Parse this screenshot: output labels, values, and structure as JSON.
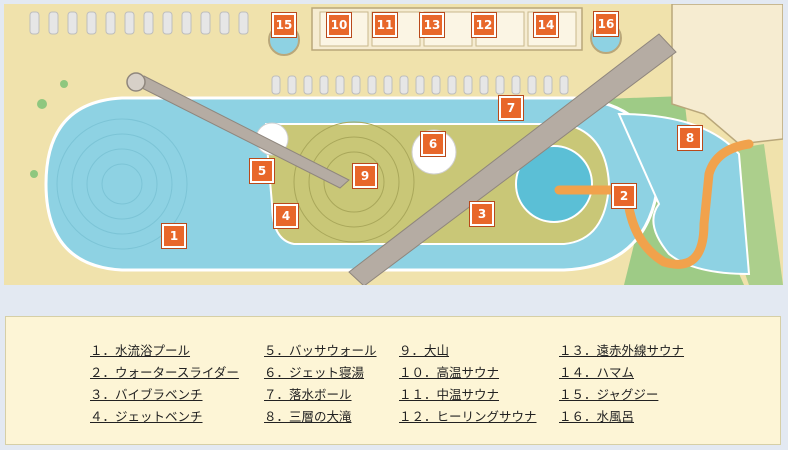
{
  "map": {
    "markers": [
      {
        "id": "1",
        "label": "1"
      },
      {
        "id": "2",
        "label": "2"
      },
      {
        "id": "3",
        "label": "3"
      },
      {
        "id": "4",
        "label": "4"
      },
      {
        "id": "5",
        "label": "5"
      },
      {
        "id": "6",
        "label": "6"
      },
      {
        "id": "7",
        "label": "7"
      },
      {
        "id": "8",
        "label": "8"
      },
      {
        "id": "9",
        "label": "9"
      },
      {
        "id": "10",
        "label": "10"
      },
      {
        "id": "11",
        "label": "11"
      },
      {
        "id": "12",
        "label": "12"
      },
      {
        "id": "13",
        "label": "13"
      },
      {
        "id": "14",
        "label": "14"
      },
      {
        "id": "15",
        "label": "15"
      },
      {
        "id": "16",
        "label": "16"
      }
    ],
    "colors": {
      "sand": "#f0e2ac",
      "pool": "#8ed2e3",
      "island": "#c9c777",
      "slide": "#f1a24c",
      "marker": "#e8672a",
      "greenery": "#7fbf7b"
    }
  },
  "legend": {
    "items": [
      "１．水流浴プール",
      "２．ウォータースライダー",
      "３．バイブラベンチ",
      "４．ジェットベンチ",
      "５．バッサウォール",
      "６．ジェット寝湯",
      "７．落水ボール",
      "８．三層の大滝",
      "９．大山",
      "１０．高温サウナ",
      "１１．中温サウナ",
      "１２．ヒーリングサウナ",
      "１３．遠赤外線サウナ",
      "１４．ハマム",
      "１５．ジャグジー",
      "１６．水風呂"
    ]
  }
}
